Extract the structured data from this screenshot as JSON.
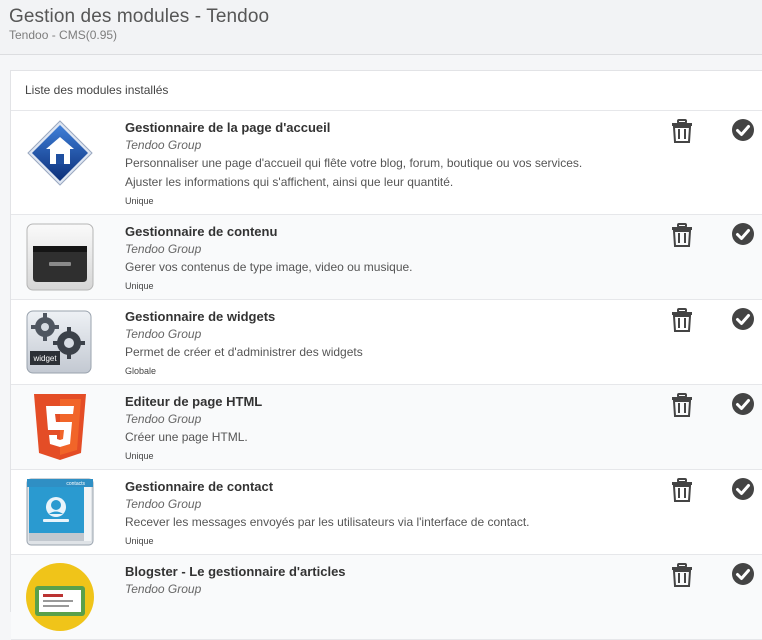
{
  "header": {
    "title": "Gestion des modules - Tendoo",
    "subtitle": "Tendoo - CMS(0.95)"
  },
  "panel": {
    "heading": "Liste des modules installés"
  },
  "modules": [
    {
      "name": "Gestionnaire de la page d'accueil",
      "author": "Tendoo Group",
      "description": [
        "Personnaliser une page d'accueil qui flête votre blog, forum, boutique ou vos services.",
        "Ajuster les informations qui s'affichent, ainsi que leur quantité."
      ],
      "type": "Unique",
      "icon": "home-diamond-icon"
    },
    {
      "name": "Gestionnaire de contenu",
      "author": "Tendoo Group",
      "description": [
        "Gerer vos contenus de type image, video ou musique."
      ],
      "type": "Unique",
      "icon": "drawer-icon"
    },
    {
      "name": "Gestionnaire de widgets",
      "author": "Tendoo Group",
      "description": [
        "Permet de créer et d'administrer des widgets"
      ],
      "type": "Globale",
      "icon": "widget-gears-icon",
      "icon_label": "widget"
    },
    {
      "name": "Editeur de page HTML",
      "author": "Tendoo Group",
      "description": [
        "Créer une page HTML."
      ],
      "type": "Unique",
      "icon": "html5-icon"
    },
    {
      "name": "Gestionnaire de contact",
      "author": "Tendoo Group",
      "description": [
        "Recever les messages envoyés par les utilisateurs via l'interface de contact."
      ],
      "type": "Unique",
      "icon": "contact-card-icon",
      "icon_label": "contacts"
    },
    {
      "name": "Blogster - Le gestionnaire d'articles",
      "author": "Tendoo Group",
      "description": [],
      "type": "",
      "icon": "blog-icon"
    }
  ],
  "actions": {
    "delete_icon": "trash-icon",
    "activate_icon": "check-circle-icon"
  },
  "colors": {
    "accent_blue": "#1f4fa0",
    "html5_orange": "#e44d26",
    "icon_dark": "#444444"
  }
}
